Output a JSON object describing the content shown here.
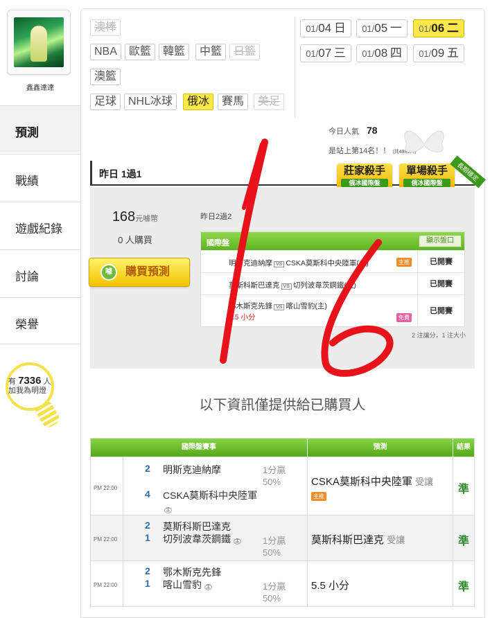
{
  "sidebar": {
    "username": "鑫鑫達達",
    "nav": [
      {
        "label": "預測"
      },
      {
        "label": "戰績"
      },
      {
        "label": "遊戲紀錄"
      },
      {
        "label": "討論"
      },
      {
        "label": "榮譽"
      }
    ],
    "lamp": {
      "prefix": "有",
      "count": "7336",
      "suffix": "人",
      "caption": "加我為明燈"
    }
  },
  "sports": [
    {
      "label": "澳棒"
    },
    {
      "label": "NBA"
    },
    {
      "label": "歐籃"
    },
    {
      "label": "韓籃"
    },
    {
      "label": "中籃"
    },
    {
      "label": "日籃"
    },
    {
      "label": "澳籃"
    },
    {
      "label": "足球"
    },
    {
      "label": "NHL冰球"
    },
    {
      "label": "俄冰"
    },
    {
      "label": "賽馬"
    },
    {
      "label": "美足"
    }
  ],
  "dates": [
    {
      "md": "01/",
      "day": "04",
      "wd": "日"
    },
    {
      "md": "01/",
      "day": "05",
      "wd": "一"
    },
    {
      "md": "01/",
      "day": "06",
      "wd": "二"
    },
    {
      "md": "01/",
      "day": "07",
      "wd": "三"
    },
    {
      "md": "01/",
      "day": "08",
      "wd": "四"
    },
    {
      "md": "01/",
      "day": "09",
      "wd": "五"
    }
  ],
  "popularity": {
    "label": "今日人氣",
    "value": "78",
    "rank_text": "是站上第14名！！",
    "rank_note": "(共4989人)"
  },
  "yesterday": {
    "title": "昨日 1過1",
    "badges": [
      {
        "title": "莊家殺手",
        "sub": "俄冰國際盤"
      },
      {
        "title": "單場殺手",
        "sub": "俄冰國際盤"
      },
      {
        "ribbon": "長期穩定"
      }
    ],
    "credits": "168",
    "credits_unit": "元噱幣",
    "buyers": "0 人購買",
    "buy_button": "購買預測",
    "result_summary": "昨日2過2",
    "intl_label": "國際盤",
    "toggle_label": "顯示盤口",
    "games": [
      {
        "text": "明斯克迪納摩",
        "vs": "VS",
        "text2": "CSKA莫斯科中央陸軍(主)",
        "tag": "主推",
        "result": "已開賽"
      },
      {
        "text": "莫斯科斯巴達克",
        "vs": "VS",
        "text2": "切列波韋茨鋼鐵(主)",
        "tag": "",
        "result": "已開賽"
      },
      {
        "text": "鄂木斯克先鋒",
        "vs": "VS",
        "text2": "喀山雪豹(主)",
        "sub": "5.5 小分",
        "tag": "免費",
        "result": "已開賽"
      }
    ],
    "footnote": "2 注讓分，1 注大小"
  },
  "info_title": "以下資訊僅提供給已購買人",
  "table": {
    "headers": {
      "event": "國際盤賽事",
      "prediction": "預測",
      "result": "結果"
    },
    "rows": [
      {
        "time": "PM 22:00",
        "n1": "2",
        "t1": "明斯克迪納摩",
        "n2": "4",
        "t2": "CSKA莫斯科中央陸軍",
        "home": "主",
        "odds": "1分贏",
        "odds2": "50%",
        "pred": "CSKA莫斯科中央陸軍",
        "pred_note": "受讓",
        "tag": "主推",
        "result": "準"
      },
      {
        "time": "PM 22:00",
        "n1": "2",
        "t1": "莫斯科斯巴達克",
        "n2": "1",
        "t2": "切列波韋茨鋼鐵",
        "home": "主",
        "odds": "1分贏",
        "odds2": "50%",
        "pred": "莫斯科斯巴達克",
        "pred_note": "受讓",
        "tag": "",
        "result": "準"
      },
      {
        "time": "PM 22:00",
        "n1": "2",
        "t1": "鄂木斯克先鋒",
        "n2": "1",
        "t2": "喀山雪豹",
        "home": "主",
        "odds": "1分贏",
        "odds2": "50%",
        "pred": "5.5 小分",
        "pred_note": "",
        "tag": "",
        "result": "準"
      }
    ]
  },
  "colors": {
    "accent_green": "#5fb320",
    "highlight_yellow": "#ffe94a",
    "annotation_red": "#e8121a"
  }
}
